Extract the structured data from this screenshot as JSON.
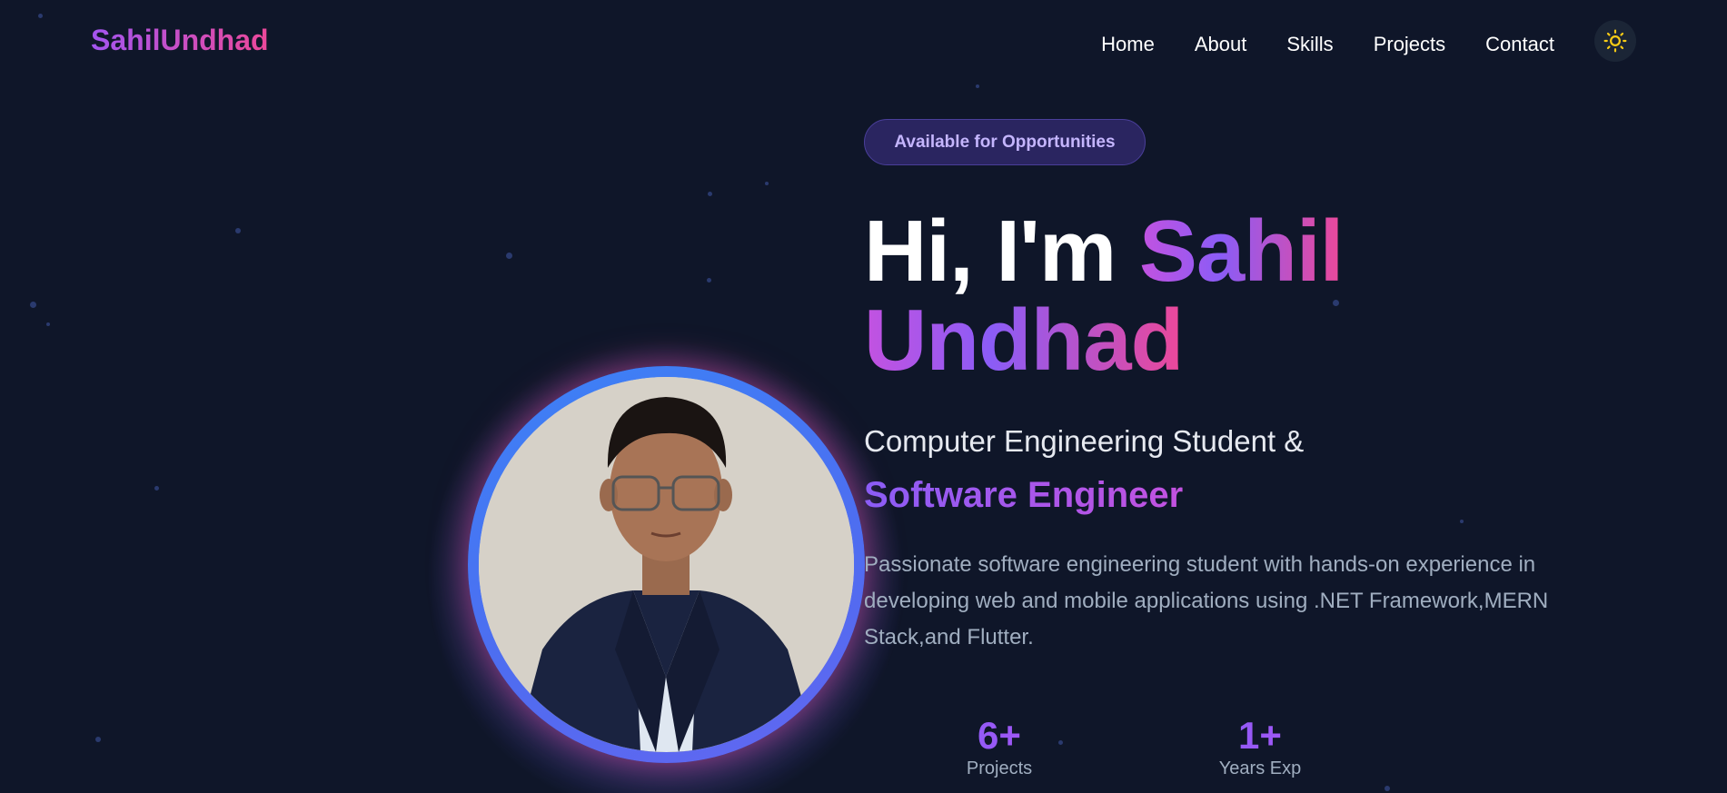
{
  "nav": {
    "logo": "SahilUndhad",
    "links": [
      "Home",
      "About",
      "Skills",
      "Projects",
      "Contact"
    ],
    "theme_icon": "sun-icon"
  },
  "hero": {
    "badge": "Available for Opportunities",
    "greeting": "Hi, I'm",
    "first_name": "Sahil",
    "last_name": "Undhad",
    "subtitle_line1": "Computer Engineering Student &",
    "subtitle_line2": "Software Engineer",
    "description": "Passionate software engineering student with hands-on experience in developing web and mobile applications using .NET Framework,MERN Stack,and Flutter.",
    "stats": [
      {
        "value": "6+",
        "label": "Projects"
      },
      {
        "value": "1+",
        "label": "Years Exp"
      }
    ]
  },
  "colors": {
    "background": "#0f1629",
    "accent_purple": "#8b5cf6",
    "accent_pink": "#ec4899",
    "ring_blue": "#3b82f6"
  }
}
